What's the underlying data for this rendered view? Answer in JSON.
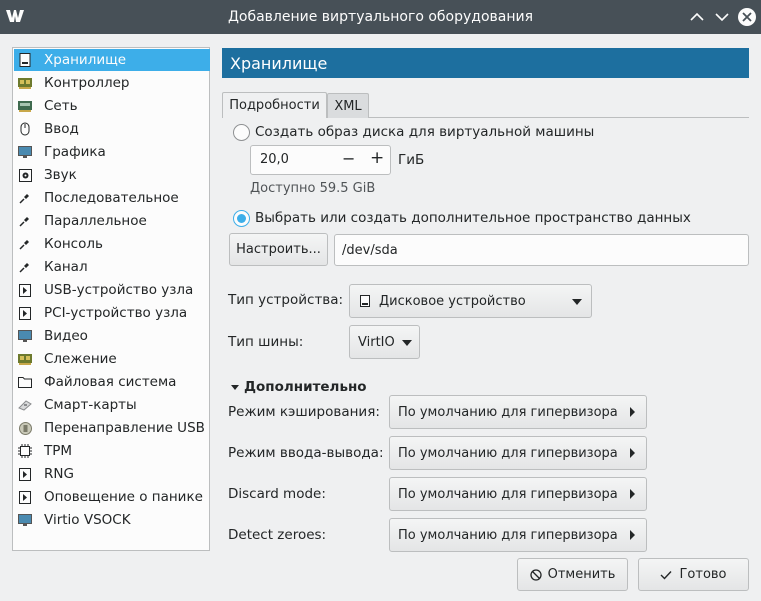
{
  "window": {
    "title": "Добавление виртуального оборудования"
  },
  "sidebar": {
    "items": [
      {
        "label": "Хранилище",
        "icon": "disk-icon",
        "selected": true
      },
      {
        "label": "Контроллер",
        "icon": "controller-card-icon"
      },
      {
        "label": "Сеть",
        "icon": "network-card-icon"
      },
      {
        "label": "Ввод",
        "icon": "mouse-icon"
      },
      {
        "label": "Графика",
        "icon": "monitor-icon"
      },
      {
        "label": "Звук",
        "icon": "speaker-icon"
      },
      {
        "label": "Последовательное",
        "icon": "serial-cable-icon"
      },
      {
        "label": "Параллельное",
        "icon": "parallel-cable-icon"
      },
      {
        "label": "Консоль",
        "icon": "console-cable-icon"
      },
      {
        "label": "Канал",
        "icon": "channel-cable-icon"
      },
      {
        "label": "USB-устройство узла",
        "icon": "usb-device-icon"
      },
      {
        "label": "PCI-устройство узла",
        "icon": "pci-device-icon"
      },
      {
        "label": "Видео",
        "icon": "video-monitor-icon"
      },
      {
        "label": "Слежение",
        "icon": "watchdog-card-icon"
      },
      {
        "label": "Файловая система",
        "icon": "folder-icon"
      },
      {
        "label": "Смарт-карты",
        "icon": "smartcard-icon"
      },
      {
        "label": "Перенаправление USB",
        "icon": "usb-redirect-icon"
      },
      {
        "label": "TPM",
        "icon": "chip-icon"
      },
      {
        "label": "RNG",
        "icon": "rng-device-icon"
      },
      {
        "label": "Оповещение о панике",
        "icon": "panic-device-icon"
      },
      {
        "label": "Virtio VSOCK",
        "icon": "vsock-icon"
      }
    ]
  },
  "main": {
    "header": "Хранилище",
    "tabs": [
      {
        "label": "Подробности",
        "active": true
      },
      {
        "label": "XML",
        "active": false
      }
    ],
    "create_disk": {
      "label": "Создать образ диска для виртуальной машины",
      "checked": false,
      "size_value": "20,0",
      "size_unit": "ГиБ",
      "minus": "−",
      "plus": "+",
      "available": "Доступно 59.5 GiB"
    },
    "select_storage": {
      "label": "Выбрать или создать дополнительное пространство данных",
      "checked": true,
      "configure_button": "Настроить...",
      "path_value": "/dev/sda"
    },
    "device_type": {
      "label": "Тип устройства:",
      "value": "Дисковое устройство"
    },
    "bus_type": {
      "label": "Тип шины:",
      "value": "VirtIO"
    },
    "advanced": {
      "label": "Дополнительно",
      "expanded": true,
      "rows": [
        {
          "label": "Режим кэширования:",
          "value": "По умолчанию для гипервизора"
        },
        {
          "label": "Режим ввода-вывода:",
          "value": "По умолчанию для гипервизора"
        },
        {
          "label": "Discard mode:",
          "value": "По умолчанию для гипервизора"
        },
        {
          "label": "Detect zeroes:",
          "value": "По умолчанию для гипервизора"
        }
      ]
    }
  },
  "footer": {
    "cancel_label": "Отменить",
    "ok_label": "Готово"
  },
  "colors": {
    "titlebar": "#475057",
    "selection": "#3daee9",
    "header": "#1d6f9f",
    "window_bg": "#eff0f1"
  }
}
